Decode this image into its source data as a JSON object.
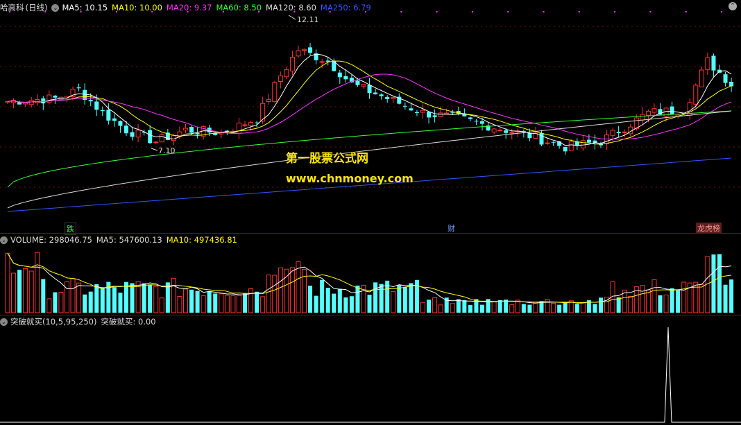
{
  "main": {
    "stock": "哈高科",
    "period": "(日线)",
    "ma": [
      {
        "label": "MA5: 10.15",
        "color": "#ffffff"
      },
      {
        "label": "MA10: 10.00",
        "color": "#ffff00"
      },
      {
        "label": "MA20: 9.37",
        "color": "#ff33ff"
      },
      {
        "label": "MA60: 8.50",
        "color": "#33ff33"
      },
      {
        "label": "MA120: 8.60",
        "color": "#dddddd"
      },
      {
        "label": "MA250: 6.79",
        "color": "#3355ff"
      }
    ],
    "high_label": "12.11",
    "low_label": "7.10",
    "events": [
      {
        "label": "跌",
        "color": "#33ff33"
      },
      {
        "label": "财",
        "color": "#6699ff"
      },
      {
        "label": "龙虎榜",
        "color": "#ff6666"
      }
    ]
  },
  "watermark": {
    "line1": "第一股票公式网",
    "line2": "www.chnmoney.com"
  },
  "volume": {
    "title": "VOLUME: 298046.75",
    "ma5": "MA5: 547600.13",
    "ma10": "MA10: 497436.81"
  },
  "indicator": {
    "title": "突破就买(10,5,95,250)",
    "value": "突破就买: 0.00"
  },
  "colors": {
    "up": "#ff3333",
    "down": "#54ffff",
    "bg": "#000000"
  },
  "chart_data": {
    "type": "candlestick",
    "high": 12.11,
    "low": 7.1,
    "up_color": "#ff3333",
    "down_color": "#54ffff",
    "panels": [
      "price",
      "volume",
      "indicator"
    ],
    "indicator_signal_value": 1.0
  }
}
